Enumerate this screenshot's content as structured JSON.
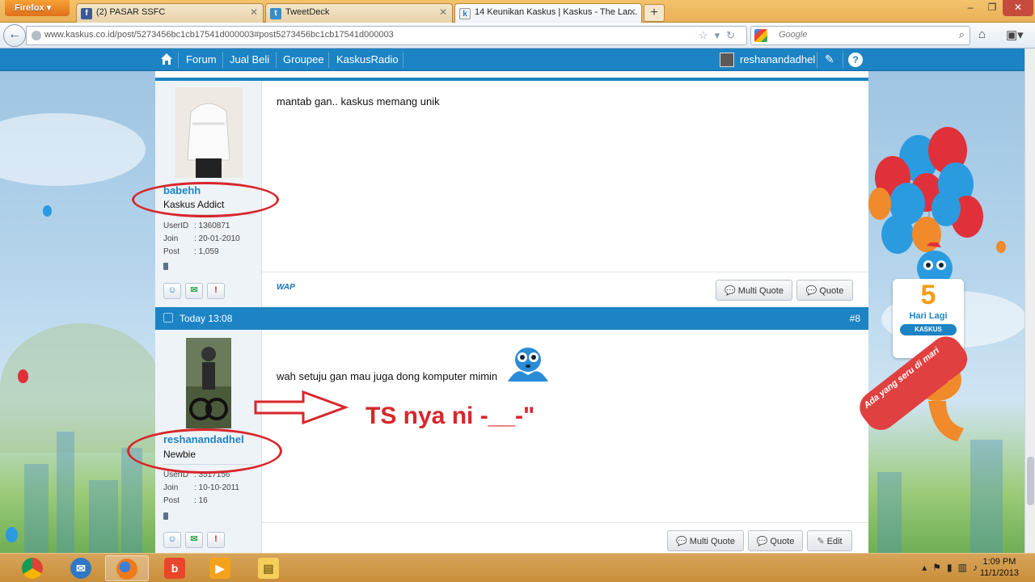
{
  "browser": {
    "menu_label": "Firefox",
    "tabs": [
      {
        "title": "(2) PASAR SSFC",
        "icon": "facebook-icon"
      },
      {
        "title": "TweetDeck",
        "icon": "tweetdeck-icon"
      },
      {
        "title": "14 Keunikan Kaskus | Kaskus - The Lar...",
        "icon": "kaskus-icon"
      }
    ],
    "url": "www.kaskus.co.id/post/5273456bc1cb17541d000003#post5273456bc1cb17541d000003",
    "search_placeholder": "Google"
  },
  "site_nav": {
    "items": [
      "Forum",
      "Jual Beli",
      "Groupee",
      "KaskusRadio"
    ],
    "username": "reshanandadhel"
  },
  "posts": [
    {
      "username": "babehh",
      "rank": "Kaskus Addict",
      "stats": [
        {
          "label": "UserID",
          "value": ": 1360871"
        },
        {
          "label": "Join",
          "value": ": 20-01-2010"
        },
        {
          "label": "Post",
          "value": ": 1,059"
        }
      ],
      "body": "mantab gan.. kaskus memang unik",
      "wap_label": "WAP",
      "buttons": [
        "Multi Quote",
        "Quote"
      ]
    },
    {
      "time": "Today 13:08",
      "number": "#8",
      "username": "reshanandadhel",
      "rank": "Newbie",
      "stats": [
        {
          "label": "UserID",
          "value": ": 3517156"
        },
        {
          "label": "Join",
          "value": ": 10-10-2011"
        },
        {
          "label": "Post",
          "value": ": 16"
        }
      ],
      "body": "wah setuju gan mau juga dong komputer mimin",
      "buttons": [
        "Multi Quote",
        "Quote",
        "Edit"
      ]
    }
  ],
  "annotation": {
    "text": "TS nya ni -__-\"",
    "color": "#d8262b"
  },
  "promo": {
    "number": "5",
    "text": "Hari Lagi",
    "logo": "KASKUS",
    "slogan": "Ada yang seru di mari"
  },
  "taskbar": {
    "apps": [
      "chrome-icon",
      "thunderbird-icon",
      "firefox-icon",
      "bebo-icon",
      "media-player-icon",
      "file-explorer-icon"
    ],
    "time": "1:09 PM",
    "date": "11/1/2013"
  },
  "colors": {
    "accent": "#1c83c4",
    "annotation": "#d8262b"
  }
}
